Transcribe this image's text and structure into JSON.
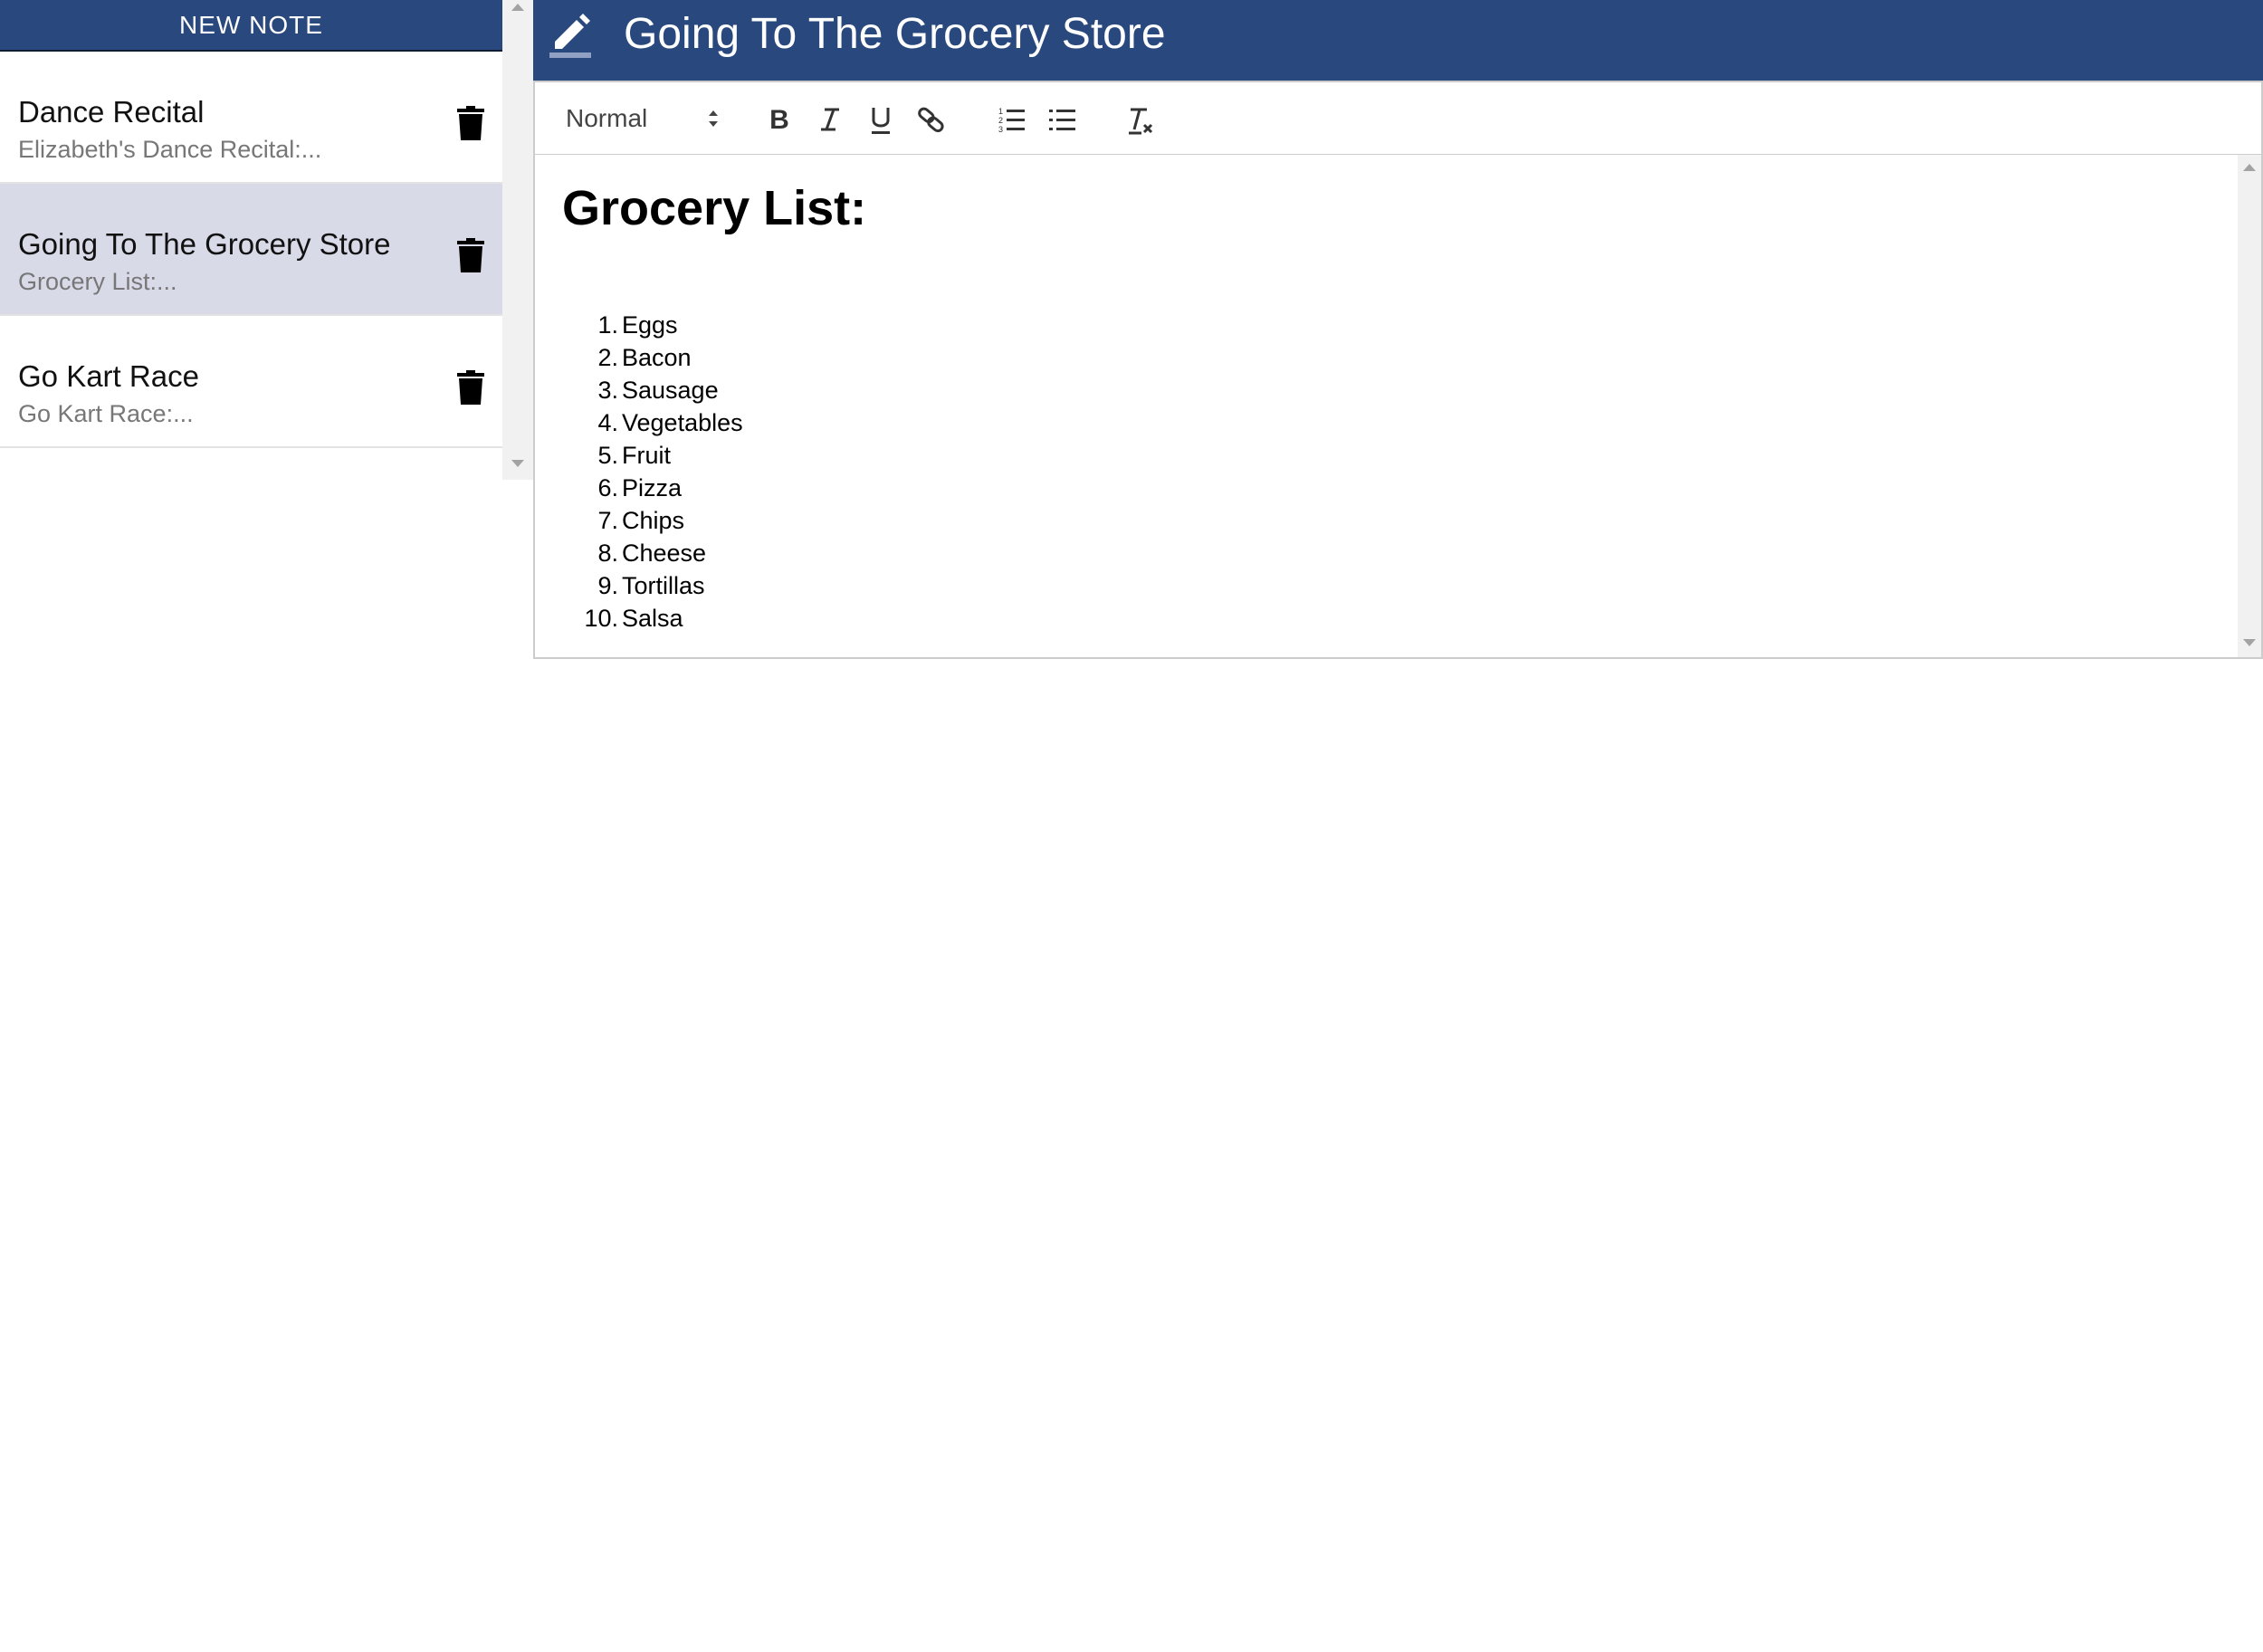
{
  "colors": {
    "header_bg": "#29487d",
    "selected_item_bg": "#d8dae8",
    "preview_text": "#777777"
  },
  "sidebar": {
    "new_note_label": "NEW NOTE",
    "notes": [
      {
        "title": "Dance Recital",
        "preview": "Elizabeth's Dance Recital:...",
        "selected": false
      },
      {
        "title": "Going To The Grocery Store",
        "preview": "Grocery List:...",
        "selected": true
      },
      {
        "title": "Go Kart Race",
        "preview": "Go Kart Race:...",
        "selected": false
      }
    ]
  },
  "editor": {
    "title": "Going To The Grocery Store",
    "toolbar": {
      "format_value": "Normal",
      "buttons": [
        "bold-icon",
        "italic-icon",
        "underline-icon",
        "link-icon",
        "ordered-list-icon",
        "bullet-list-icon",
        "clear-format-icon"
      ]
    },
    "content": {
      "heading": "Grocery List:",
      "items": [
        {
          "num": "1.",
          "text": "Eggs"
        },
        {
          "num": "2.",
          "text": "Bacon"
        },
        {
          "num": "3.",
          "text": "Sausage"
        },
        {
          "num": "4.",
          "text": "Vegetables"
        },
        {
          "num": "5.",
          "text": "Fruit"
        },
        {
          "num": "6.",
          "text": "Pizza"
        },
        {
          "num": "7.",
          "text": "Chips"
        },
        {
          "num": "8.",
          "text": "Cheese"
        },
        {
          "num": "9.",
          "text": "Tortillas"
        },
        {
          "num": "10.",
          "text": "Salsa"
        }
      ]
    }
  }
}
